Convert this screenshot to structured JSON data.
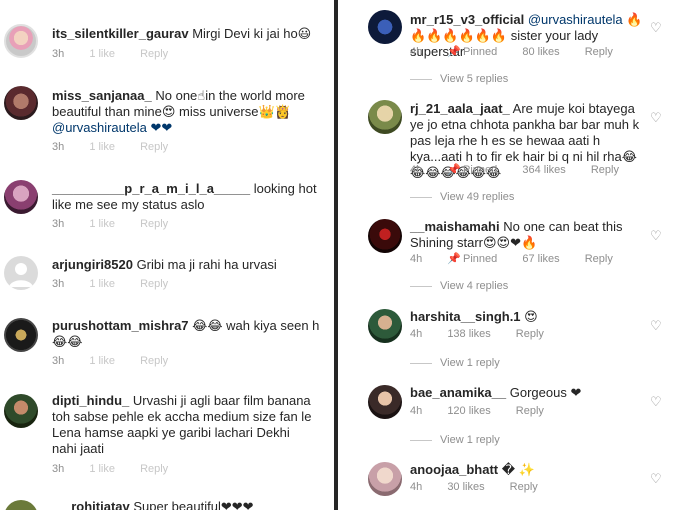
{
  "left": {
    "comments": [
      {
        "username": "its_silentkiller_gaurav",
        "text": "Mirgi Devi ki jai ho😃",
        "time": "3h",
        "likes": "1 like",
        "reply": "Reply"
      },
      {
        "username": "miss_sanjanaa_",
        "text": "No one☝in the world more beautiful than mine😍  miss universe👑👸",
        "mention": "@urvashirautela ❤❤",
        "time": "3h",
        "likes": "1 like",
        "reply": "Reply"
      },
      {
        "username": "__________p_r_a_m_i_l_a_____",
        "text": "looking hot like me see my status aslo",
        "time": "3h",
        "likes": "1 like",
        "reply": "Reply"
      },
      {
        "username": "arjungiri8520",
        "text": "Gribi ma ji rahi ha urvasi",
        "time": "3h",
        "likes": "1 like",
        "reply": "Reply"
      },
      {
        "username": "purushottam_mishra7",
        "text": "😂😂 wah kiya seen h 😂😂",
        "time": "3h",
        "likes": "1 like",
        "reply": "Reply"
      },
      {
        "username": "dipti_hindu_",
        "text": "Urvashi ji agli baar film banana toh sabse pehle ek accha medium size fan le Lena hamse aapki ye garibi lachari Dekhi nahi jaati",
        "time": "3h",
        "likes": "1 like",
        "reply": "Reply"
      },
      {
        "username": "_rohitjatav",
        "text": "Super  beautiful❤❤❤"
      }
    ]
  },
  "right": {
    "comments": [
      {
        "username": "mr_r15_v3_official",
        "mention": "@urvashirautela",
        "text": "🔥🔥🔥🔥🔥🔥🔥 sister your lady superstar",
        "time": "4h",
        "pinned": "Pinned",
        "likes": "80 likes",
        "reply": "Reply",
        "view_replies": "View 5 replies"
      },
      {
        "username": "rj_21_aala_jaat_",
        "text": "Are muje koi btayega ye jo etna chhota pankha bar bar muh k pas leja rhe h es se hewaa aati h kya...aati h to fir ek hair bi q ni hil rha😂😂😂😂😂😂😂",
        "time": "4h",
        "pinned": "Pinned",
        "likes": "364 likes",
        "reply": "Reply",
        "view_replies": "View 49 replies"
      },
      {
        "username": "__maishamahi",
        "text": "No one can beat this Shining starr😍😍❤🔥",
        "time": "4h",
        "pinned": "Pinned",
        "likes": "67 likes",
        "reply": "Reply",
        "view_replies": "View 4 replies"
      },
      {
        "username": "harshita__singh.1",
        "text": "😍",
        "time": "4h",
        "likes": "138 likes",
        "reply": "Reply",
        "view_replies": "View 1 reply"
      },
      {
        "username": "bae_anamika__",
        "text": "Gorgeous ❤",
        "time": "4h",
        "likes": "120 likes",
        "reply": "Reply",
        "view_replies": "View 1 reply"
      },
      {
        "username": "anoojaa_bhatt",
        "text": "� ✨",
        "time": "4h",
        "likes": "30 likes",
        "reply": "Reply"
      }
    ]
  },
  "icons": {
    "heart": "heart-outline-icon",
    "pin": "pin-icon"
  },
  "colors": {
    "meta": "#8e8e8e",
    "faint": "#c7c7c7",
    "text": "#262626",
    "heart_red": "#ed4956"
  }
}
